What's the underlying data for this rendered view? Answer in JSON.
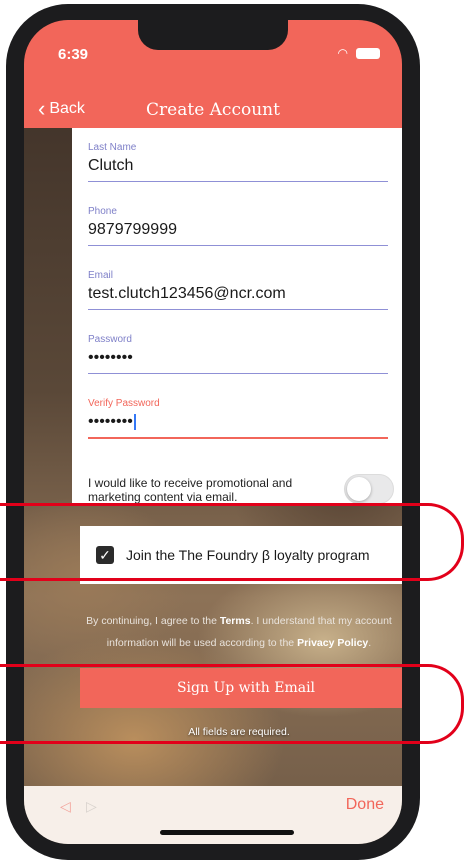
{
  "status_bar": {
    "time": "6:39"
  },
  "nav": {
    "back_label": "Back",
    "title": "Create Account"
  },
  "form": {
    "last_name": {
      "label": "Last Name",
      "value": "Clutch"
    },
    "phone": {
      "label": "Phone",
      "value": "9879799999"
    },
    "email": {
      "label": "Email",
      "value": "test.clutch123456@ncr.com"
    },
    "password": {
      "label": "Password",
      "value": "••••••••"
    },
    "verify_password": {
      "label": "Verify Password",
      "value": "••••••••"
    },
    "promo_label": "I would like to receive promotional and marketing content via email."
  },
  "loyalty": {
    "label": "Join the The Foundry β loyalty program",
    "checked": true
  },
  "legal": {
    "prefix": "By continuing, I agree to the ",
    "terms": "Terms",
    "middle": ". I understand that my account information will be used according to the ",
    "privacy": "Privacy Policy",
    "suffix": "."
  },
  "signup_button": "Sign Up with Email",
  "required_note": "All fields are required.",
  "bottom_bar": {
    "done_label": "Done"
  },
  "colors": {
    "accent": "#f2665a",
    "highlight": "#e2001a",
    "field_label": "#7f80c8"
  }
}
